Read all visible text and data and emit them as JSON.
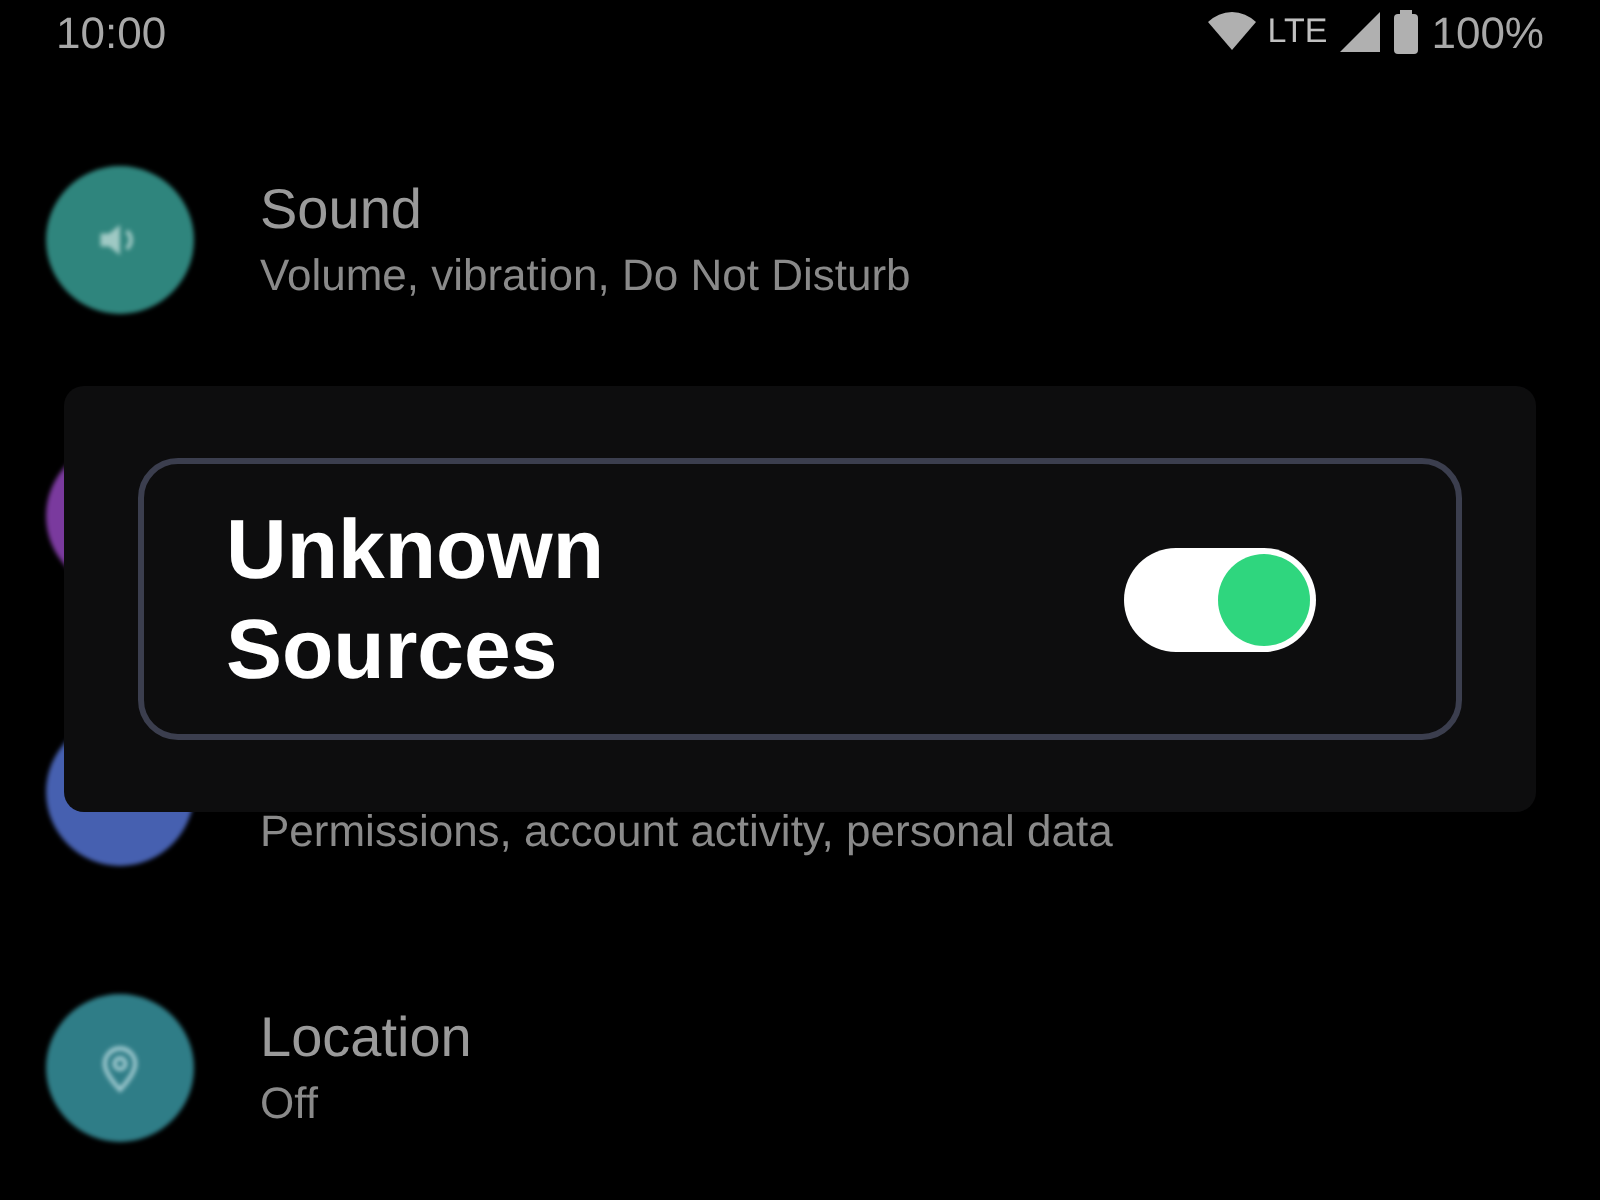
{
  "status_bar": {
    "time": "10:00",
    "network": "LTE",
    "battery": "100%"
  },
  "settings": [
    {
      "kind": "speaker",
      "color": "#2f857d",
      "title": "Sound",
      "subtitle": "Volume, vibration, Do Not Disturb"
    },
    {
      "kind": "plain",
      "color": "#7a3a9e"
    },
    {
      "kind": "plain",
      "color": "#4660b0",
      "subtitle": "Permissions, account activity, personal data"
    },
    {
      "kind": "pin",
      "color": "#2f7d87",
      "title": "Location",
      "subtitle": "Off"
    }
  ],
  "dialog": {
    "label": "Unknown Sources",
    "toggle": {
      "on": true
    }
  }
}
